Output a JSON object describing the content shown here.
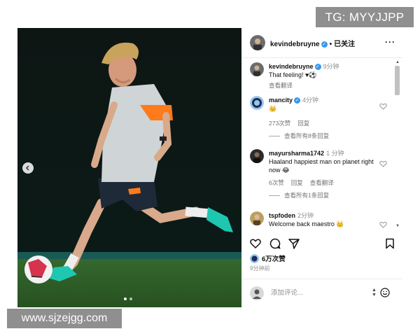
{
  "watermarks": {
    "top": "TG: MYYJJPP",
    "bottom": "www.sjzejgg.com"
  },
  "post": {
    "username": "kevindebruyne",
    "separator": "•",
    "follow_label": "已关注",
    "more_icon": "more-horizontal-icon",
    "image_dots": 2,
    "active_dot": 1
  },
  "comments": [
    {
      "username": "kevindebruyne",
      "time": "9分钟",
      "text": "That feeling! ♥⚽",
      "actions": [
        "查看翻译"
      ],
      "verified": true,
      "liked_icon": false
    },
    {
      "username": "mancity",
      "time": "4分钟",
      "text": "👑",
      "actions": [
        "273次赞",
        "回复"
      ],
      "replies": "查看所有8条回复",
      "verified": true,
      "liked_icon": true
    },
    {
      "username": "mayursharma1742",
      "time": "1 分钟",
      "text": "Haaland happiest man on planet right now 😂",
      "actions": [
        "6次赞",
        "回复",
        "查看翻译"
      ],
      "replies": "查看所有1条回复",
      "verified": false,
      "liked_icon": true
    },
    {
      "username": "tspfoden",
      "time": "2分钟",
      "text": "Welcome back maestro 👑",
      "actions": [],
      "verified": false,
      "liked_icon": true
    }
  ],
  "actions": {
    "icons": [
      "heart-icon",
      "comment-icon",
      "share-icon",
      "bookmark-icon"
    ]
  },
  "likes": "6万次赞",
  "posted_time": "9分钟前",
  "add_comment": {
    "placeholder": "添加评论...",
    "value": ""
  },
  "colors": {
    "verified": "#3897f0",
    "jersey_accent": "#ff7a1a",
    "pitch": "#2f5a2c",
    "boots": "#1fc7b0"
  }
}
